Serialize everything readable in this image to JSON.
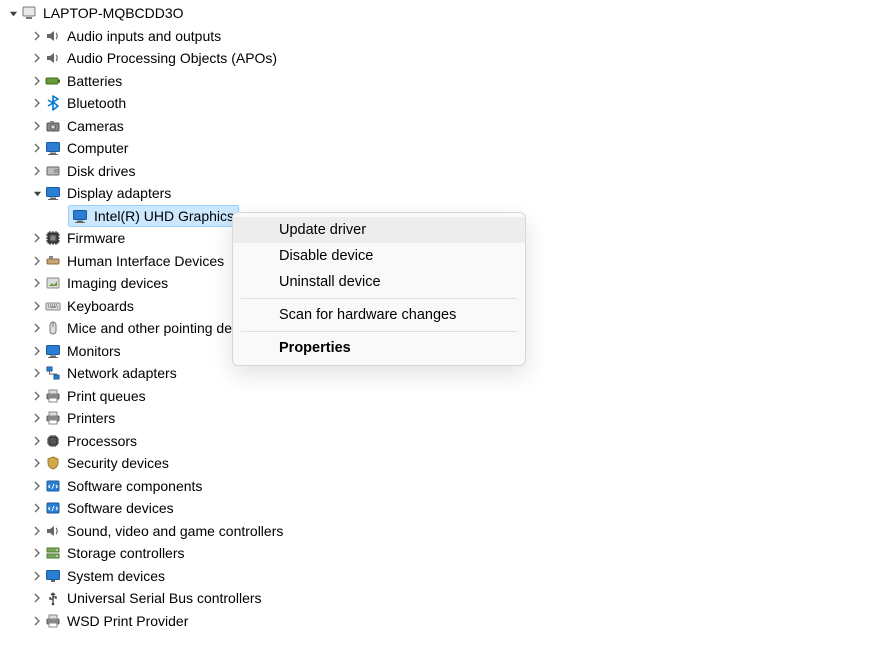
{
  "root": {
    "label": "LAPTOP-MQBCDD3O"
  },
  "categories": [
    {
      "label": "Audio inputs and outputs",
      "icon": "speaker"
    },
    {
      "label": "Audio Processing Objects (APOs)",
      "icon": "speaker"
    },
    {
      "label": "Batteries",
      "icon": "battery"
    },
    {
      "label": "Bluetooth",
      "icon": "bluetooth"
    },
    {
      "label": "Cameras",
      "icon": "camera"
    },
    {
      "label": "Computer",
      "icon": "monitor"
    },
    {
      "label": "Disk drives",
      "icon": "disk"
    },
    {
      "label": "Display adapters",
      "icon": "monitor",
      "expanded": true,
      "children": [
        {
          "label": "Intel(R) UHD Graphics",
          "icon": "monitor",
          "selected": true
        }
      ]
    },
    {
      "label": "Firmware",
      "icon": "chip"
    },
    {
      "label": "Human Interface Devices",
      "icon": "hid"
    },
    {
      "label": "Imaging devices",
      "icon": "imaging"
    },
    {
      "label": "Keyboards",
      "icon": "keyboard"
    },
    {
      "label": "Mice and other pointing devices",
      "icon": "mouse"
    },
    {
      "label": "Monitors",
      "icon": "monitor"
    },
    {
      "label": "Network adapters",
      "icon": "network"
    },
    {
      "label": "Print queues",
      "icon": "printer"
    },
    {
      "label": "Printers",
      "icon": "printer"
    },
    {
      "label": "Processors",
      "icon": "cpu"
    },
    {
      "label": "Security devices",
      "icon": "security"
    },
    {
      "label": "Software components",
      "icon": "software"
    },
    {
      "label": "Software devices",
      "icon": "software"
    },
    {
      "label": "Sound, video and game controllers",
      "icon": "speaker"
    },
    {
      "label": "Storage controllers",
      "icon": "storage"
    },
    {
      "label": "System devices",
      "icon": "system"
    },
    {
      "label": "Universal Serial Bus controllers",
      "icon": "usb"
    },
    {
      "label": "WSD Print Provider",
      "icon": "printer"
    }
  ],
  "context_menu": {
    "items": [
      {
        "label": "Update driver",
        "hover": true
      },
      {
        "label": "Disable device"
      },
      {
        "label": "Uninstall device"
      },
      {
        "sep": true
      },
      {
        "label": "Scan for hardware changes"
      },
      {
        "sep": true
      },
      {
        "label": "Properties",
        "bold": true
      }
    ]
  }
}
